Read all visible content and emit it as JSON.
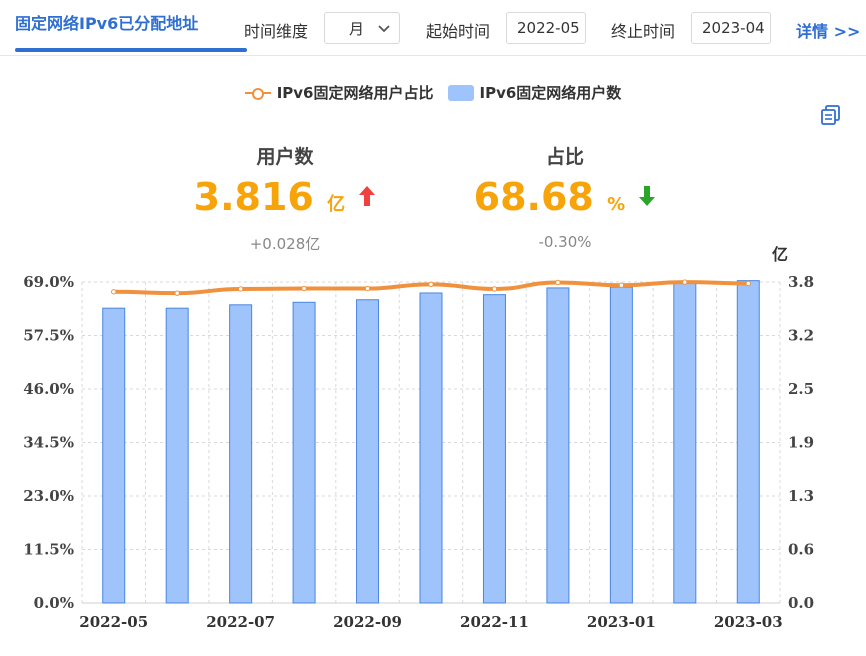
{
  "header": {
    "active_tab": "固定网络IPv6已分配地址",
    "time_dimension_label": "时间维度",
    "time_dimension_value": "月",
    "start_label": "起始时间",
    "start_value": "2022-05",
    "end_label": "终止时间",
    "end_value": "2023-04",
    "details_link": "详情 >>"
  },
  "legend": {
    "line_series": "IPv6固定网络用户占比",
    "bar_series": "IPv6固定网络用户数"
  },
  "stats": {
    "users": {
      "title": "用户数",
      "value": "3.816",
      "unit": "亿",
      "delta": "+0.028亿",
      "trend": "up"
    },
    "ratio": {
      "title": "占比",
      "value": "68.68",
      "unit": "%",
      "delta": "-0.30%",
      "trend": "down"
    }
  },
  "colors": {
    "accent": "#2f6fd1",
    "bar": "#9fc3fb",
    "bar_border": "#4a86e0",
    "line": "#f0913d",
    "value": "#f7a30a",
    "up": "#f04040",
    "down": "#2aa52a"
  },
  "chart_data": {
    "type": "bar",
    "categories": [
      "2022-05",
      "2022-06",
      "2022-07",
      "2022-08",
      "2022-09",
      "2022-10",
      "2022-11",
      "2022-12",
      "2023-01",
      "2023-02",
      "2023-03"
    ],
    "xtick_labels": [
      "2022-05",
      "2022-07",
      "2022-09",
      "2022-11",
      "2023-01",
      "2023-03"
    ],
    "series": [
      {
        "name": "IPv6固定网络用户数",
        "type": "bar",
        "axis": "right",
        "values": [
          3.49,
          3.49,
          3.53,
          3.56,
          3.59,
          3.67,
          3.65,
          3.73,
          3.74,
          3.79,
          3.816
        ]
      },
      {
        "name": "IPv6固定网络用户占比",
        "type": "line",
        "axis": "left",
        "values": [
          66.9,
          66.6,
          67.5,
          67.6,
          67.6,
          68.5,
          67.5,
          68.9,
          68.3,
          68.98,
          68.68
        ]
      }
    ],
    "yleft_ticks": [
      "0.0%",
      "11.5%",
      "23.0%",
      "34.5%",
      "46.0%",
      "57.5%",
      "69.0%"
    ],
    "yleft_lim": [
      0,
      69
    ],
    "yright_ticks": [
      "0.0",
      "0.6",
      "1.3",
      "1.9",
      "2.5",
      "3.2",
      "3.8"
    ],
    "yright_lim": [
      0,
      3.8
    ],
    "yright_unit": "亿",
    "grid": true
  }
}
